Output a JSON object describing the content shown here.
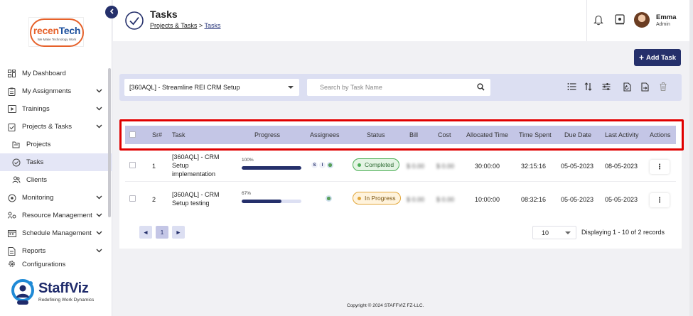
{
  "brand": {
    "client_logo_text_colored": "recen",
    "client_logo_text": "Tech",
    "client_logo_tagline": "We Make Technology Work",
    "product_name": "StaffViz",
    "product_tagline": "Redefining Work Dynamics"
  },
  "sidebar": {
    "items": [
      {
        "label": "My Dashboard",
        "icon": "dashboard-icon"
      },
      {
        "label": "My Assignments",
        "icon": "clipboard-icon",
        "expandable": true
      },
      {
        "label": "Trainings",
        "icon": "play-icon",
        "expandable": true
      },
      {
        "label": "Projects & Tasks",
        "icon": "tasks-icon",
        "expandable": true
      },
      {
        "label": "Projects",
        "icon": "folder-icon"
      },
      {
        "label": "Tasks",
        "icon": "check-circle-icon",
        "active": true
      },
      {
        "label": "Clients",
        "icon": "users-icon"
      },
      {
        "label": "Monitoring",
        "icon": "monitor-icon",
        "expandable": true
      },
      {
        "label": "Resource Management",
        "icon": "resource-icon",
        "expandable": true
      },
      {
        "label": "Schedule Management",
        "icon": "calendar-icon",
        "expandable": true
      },
      {
        "label": "Reports",
        "icon": "report-icon",
        "expandable": true
      },
      {
        "label": "Configurations",
        "icon": "gear-icon"
      }
    ]
  },
  "header": {
    "title": "Tasks",
    "breadcrumb": [
      "Projects & Tasks",
      "Tasks"
    ],
    "breadcrumb_sep": ">",
    "user_name": "Emma",
    "user_role": "Admin"
  },
  "actions": {
    "add_task": "Add Task"
  },
  "filters": {
    "project_selected": "[360AQL] - Streamline REI CRM Setup",
    "search_placeholder": "Search by Task Name"
  },
  "table": {
    "columns": [
      "Sr#",
      "Task",
      "Progress",
      "Assignees",
      "Status",
      "Bill",
      "Cost",
      "Allocated Time",
      "Time Spent",
      "Due Date",
      "Last Activity",
      "Actions"
    ],
    "rows": [
      {
        "sr": "1",
        "task": "[360AQL] - CRM Setup implementation",
        "progress_label": "100%",
        "progress": 1.0,
        "assignees": [
          "S",
          "I"
        ],
        "status": "Completed",
        "bill": "$ 0.00",
        "cost": "$ 0.00",
        "allocated": "30:00:00",
        "spent": "32:15:16",
        "due": "05-05-2023",
        "last_activity": "08-05-2023"
      },
      {
        "sr": "2",
        "task": "[360AQL] - CRM Setup testing",
        "progress_label": "67%",
        "progress": 0.67,
        "assignees": [],
        "status": "In Progress",
        "bill": "$ 0.00",
        "cost": "$ 0.00",
        "allocated": "10:00:00",
        "spent": "08:32:16",
        "due": "05-05-2023",
        "last_activity": "05-05-2023"
      }
    ]
  },
  "pagination": {
    "prev": "◄",
    "current": "1",
    "next": "►",
    "per_page": "10",
    "display": "Displaying 1 - 10 of 2 records"
  },
  "footer": {
    "copyright": "Copyright © 2024 STAFFVIZ FZ-LLC."
  },
  "colors": {
    "primary": "#25306b",
    "header_row": "#c4c6e6",
    "highlight": "#e00000",
    "completed": "#4cae56",
    "in_progress": "#e2a63a"
  }
}
